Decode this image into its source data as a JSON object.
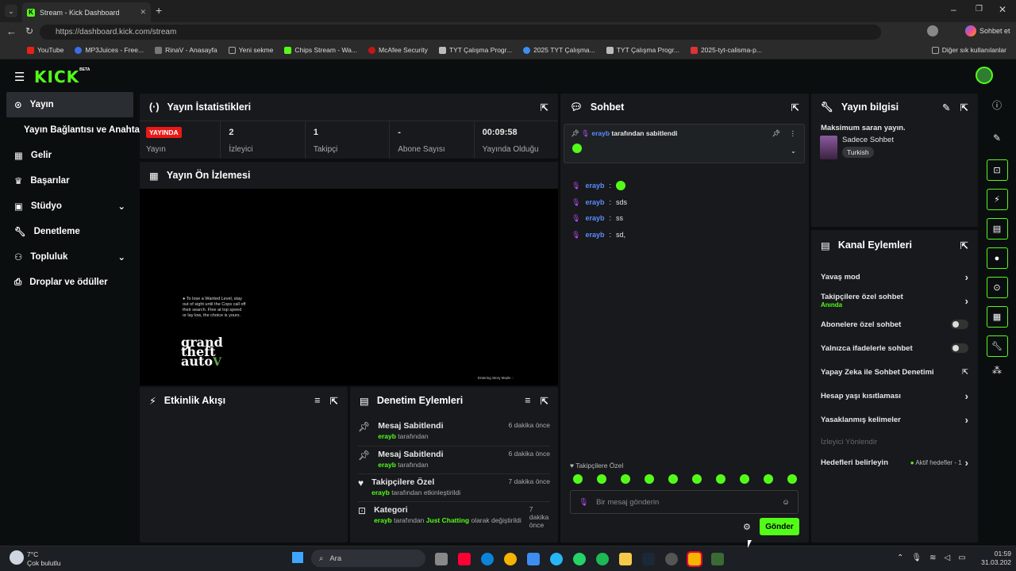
{
  "browser": {
    "tab_title": "Stream - Kick Dashboard",
    "url": "https://dashboard.kick.com/stream",
    "sohbet_et": "Sohbet et",
    "bookmarks": [
      "YouTube",
      "MP3Juices - Free...",
      "RinaV - Anasayfa",
      "Yeni sekme",
      "Chips Stream - Wa...",
      "McAfee Security",
      "TYT Çalışma Progr...",
      "2025 TYT Çalışma...",
      "TYT Çalışma Progr...",
      "2025-tyt-calisma-p..."
    ],
    "other_bookmarks": "Diğer sık kullanılanlar"
  },
  "brand": {
    "logo": "KICK",
    "badge": "BETA"
  },
  "sidebar": {
    "items": [
      {
        "label": "Yayın"
      },
      {
        "label": "Yayın Bağlantısı ve Anahtarı"
      },
      {
        "label": "Gelir"
      },
      {
        "label": "Başarılar"
      },
      {
        "label": "Stüdyo"
      },
      {
        "label": "Denetleme"
      },
      {
        "label": "Topluluk"
      },
      {
        "label": "Droplar ve ödüller"
      }
    ]
  },
  "stats": {
    "title": "Yayın İstatistikleri",
    "live_badge": "YAYINDA",
    "live_label": "Yayın",
    "cells": [
      {
        "value": "2",
        "label": "İzleyici"
      },
      {
        "value": "1",
        "label": "Takipçi"
      },
      {
        "value": "-",
        "label": "Abone Sayısı"
      },
      {
        "value": "00:09:58",
        "label": "Yayında Olduğu"
      }
    ]
  },
  "preview": {
    "title": "Yayın Ön İzlemesi",
    "tip": "To lose a Wanted Level, stay out of sight until the Cops call off their search. Flee at top speed or lay low, the choice is yours.",
    "game_logo_lines": [
      "grand",
      "theft",
      "auto"
    ],
    "game_logo_numeral": "V",
    "loading": "Entering Story Mode"
  },
  "activity": {
    "title": "Etkinlik Akışı"
  },
  "moderation": {
    "title": "Denetim Eylemleri",
    "items": [
      {
        "title": "Mesaj Sabitlendi",
        "user": "erayb",
        "rest": "tarafından",
        "time": "6 dakika önce"
      },
      {
        "title": "Mesaj Sabitlendi",
        "user": "erayb",
        "rest": "tarafından",
        "time": "6 dakika önce"
      },
      {
        "title": "Takipçilere Özel",
        "user": "erayb",
        "rest": "tarafından etkinleştirildi",
        "time": "7 dakika önce"
      },
      {
        "title": "Kategori",
        "user": "erayb",
        "rest": "tarafından",
        "highlight": "Just Chatting",
        "rest2": "olarak değiştirildi",
        "time": "7 dakika önce"
      }
    ]
  },
  "chat": {
    "title": "Sohbet",
    "pinned_user": "erayb",
    "pinned_text": "tarafından sabitlendi",
    "messages": [
      {
        "user": "erayb",
        "text": "sds"
      },
      {
        "user": "erayb",
        "text": "ss"
      },
      {
        "user": "erayb",
        "text": "sd,"
      }
    ],
    "mode": "Takipçilere Özel",
    "placeholder": "Bir mesaj gönderin",
    "send": "Gönder"
  },
  "info": {
    "title": "Yayın bilgisi",
    "stream_title": "Maksimum saran yayın.",
    "category": "Sadece Sohbet",
    "language": "Turkish"
  },
  "actions": {
    "title": "Kanal Eylemleri",
    "items": [
      {
        "label": "Yavaş mod"
      },
      {
        "label": "Takipçilere özel sohbet",
        "sub": "Anında"
      },
      {
        "label": "Abonelere özel sohbet"
      },
      {
        "label": "Yalnızca ifadelerle sohbet"
      },
      {
        "label": "Yapay Zeka ile Sohbet Denetimi"
      },
      {
        "label": "Hesap yaşı kısıtlaması"
      },
      {
        "label": "Yasaklanmış kelimeler"
      },
      {
        "label": "İzleyici Yönlendir"
      },
      {
        "label": "Hedefleri belirleyin",
        "meta": "Aktif hedefler - 1"
      }
    ]
  },
  "taskbar": {
    "temp": "7°C",
    "weather": "Çok bulutlu",
    "search": "Ara",
    "time": "01:59",
    "date": "31.03.202"
  },
  "colors": {
    "accent": "#53fc18",
    "live": "#e91916",
    "bg": "#0b0e0f",
    "panel": "#17191c"
  }
}
